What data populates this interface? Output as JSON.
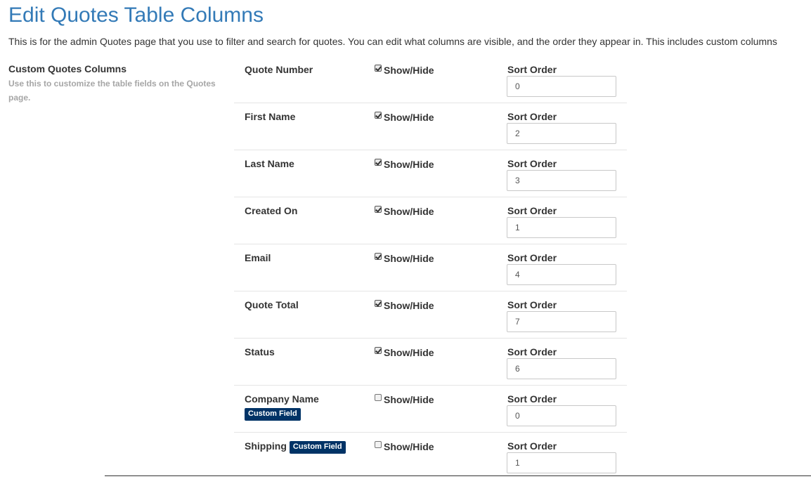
{
  "page": {
    "title": "Edit Quotes Table Columns",
    "description": "This is for the admin Quotes page that you use to filter and search for quotes. You can edit what columns are visible, and the order they appear in. This includes custom columns"
  },
  "section": {
    "title": "Custom Quotes Columns",
    "help": "Use this to customize the table fields on the Quotes page."
  },
  "labels": {
    "show_hide": "Show/Hide",
    "sort_order": "Sort Order",
    "custom_field": "Custom Field"
  },
  "colors": {
    "title": "#337ab7",
    "badge": "#003366",
    "help_text": "#a6a6a6"
  },
  "columns": [
    {
      "name": "Quote Number",
      "visible": true,
      "sort_order": "0",
      "custom": false
    },
    {
      "name": "First Name",
      "visible": true,
      "sort_order": "2",
      "custom": false
    },
    {
      "name": "Last Name",
      "visible": true,
      "sort_order": "3",
      "custom": false
    },
    {
      "name": "Created On",
      "visible": true,
      "sort_order": "1",
      "custom": false
    },
    {
      "name": "Email",
      "visible": true,
      "sort_order": "4",
      "custom": false
    },
    {
      "name": "Quote Total",
      "visible": true,
      "sort_order": "7",
      "custom": false
    },
    {
      "name": "Status",
      "visible": true,
      "sort_order": "6",
      "custom": false
    },
    {
      "name": "Company Name",
      "visible": false,
      "sort_order": "0",
      "custom": true,
      "badge_position": "below"
    },
    {
      "name": "Shipping",
      "visible": false,
      "sort_order": "1",
      "custom": true,
      "badge_position": "inline"
    }
  ]
}
